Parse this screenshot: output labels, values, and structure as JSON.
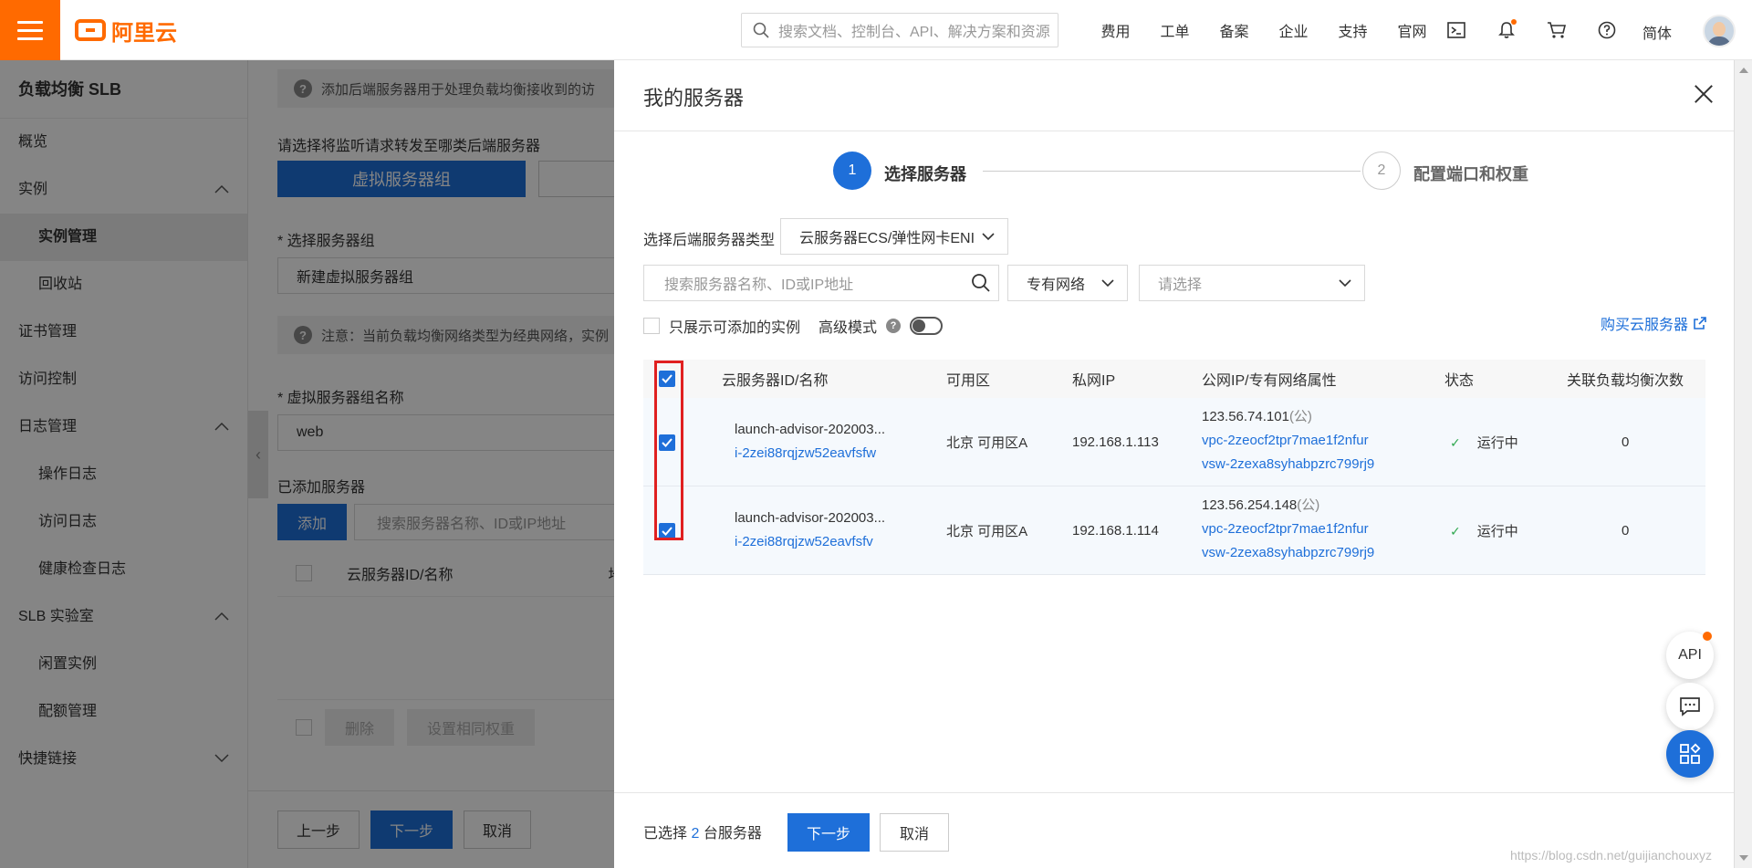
{
  "topbar": {
    "logo_text": "阿里云",
    "search_placeholder": "搜索文档、控制台、API、解决方案和资源",
    "nav": [
      "费用",
      "工单",
      "备案",
      "企业",
      "支持",
      "官网"
    ],
    "icons": [
      "terminal-icon",
      "bell-icon",
      "cart-icon",
      "help-icon"
    ],
    "lang": "简体"
  },
  "sidebar": {
    "title": "负载均衡 SLB",
    "items": [
      {
        "label": "概览",
        "level": 0
      },
      {
        "label": "实例",
        "level": 0,
        "expand": "up"
      },
      {
        "label": "实例管理",
        "level": 1,
        "active": true
      },
      {
        "label": "回收站",
        "level": 1
      },
      {
        "label": "证书管理",
        "level": 0
      },
      {
        "label": "访问控制",
        "level": 0
      },
      {
        "label": "日志管理",
        "level": 0,
        "expand": "up"
      },
      {
        "label": "操作日志",
        "level": 1
      },
      {
        "label": "访问日志",
        "level": 1
      },
      {
        "label": "健康检查日志",
        "level": 1
      },
      {
        "label": "SLB 实验室",
        "level": 0,
        "expand": "up"
      },
      {
        "label": "闲置实例",
        "level": 1
      },
      {
        "label": "配额管理",
        "level": 1
      },
      {
        "label": "快捷链接",
        "level": 0,
        "expand": "down"
      }
    ]
  },
  "underlay": {
    "tip": "添加后端服务器用于处理负载均衡接收到的访",
    "forward_label": "请选择将监听请求转发至哪类后端服务器",
    "vgroup_btn": "虚拟服务器组",
    "select_group_label": "* 选择服务器组",
    "select_group_value": "新建虚拟服务器组",
    "note": "注意：当前负载均衡网络类型为经典网络，实例",
    "group_name_label": "* 虚拟服务器组名称",
    "group_name_value": "web",
    "added_label": "已添加服务器",
    "add_btn": "添加",
    "search_placeholder": "搜索服务器名称、ID或IP地址",
    "col_name": "云服务器ID/名称",
    "col_more": "地",
    "delete_btn": "删除",
    "same_weight_btn": "设置相同权重",
    "prev_btn": "上一步",
    "next_btn": "下一步",
    "cancel_btn": "取消"
  },
  "drawer": {
    "title": "我的服务器",
    "steps": [
      {
        "num": "1",
        "label": "选择服务器",
        "state": "active"
      },
      {
        "num": "2",
        "label": "配置端口和权重",
        "state": "pending"
      }
    ],
    "type_label": "选择后端服务器类型",
    "type_value": "云服务器ECS/弹性网卡ENI",
    "search_placeholder": "搜索服务器名称、ID或IP地址",
    "network_value": "专有网络",
    "choose_placeholder": "请选择",
    "only_addable": "只展示可添加的实例",
    "advanced_mode": "高级模式",
    "buy_link": "购买云服务器",
    "columns": [
      "云服务器ID/名称",
      "可用区",
      "私网IP",
      "公网IP/专有网络属性",
      "状态",
      "关联负载均衡次数"
    ],
    "rows": [
      {
        "name": "launch-advisor-202003...",
        "id": "i-2zei88rqjzw52eavfsfw",
        "zone": "北京 可用区A",
        "private_ip": "192.168.1.113",
        "public_ip": "123.56.74.101",
        "public_tag": "(公)",
        "vpc": "vpc-2zeocf2tpr7mae1f2nfur",
        "vsw": "vsw-2zexa8syhabpzrc799rj9",
        "status": "运行中",
        "lb_count": "0"
      },
      {
        "name": "launch-advisor-202003...",
        "id": "i-2zei88rqjzw52eavfsfv",
        "zone": "北京 可用区A",
        "private_ip": "192.168.1.114",
        "public_ip": "123.56.254.148",
        "public_tag": "(公)",
        "vpc": "vpc-2zeocf2tpr7mae1f2nfur",
        "vsw": "vsw-2zexa8syhabpzrc799rj9",
        "status": "运行中",
        "lb_count": "0"
      }
    ],
    "footer": {
      "selected_prefix": "已选择",
      "selected_count": "2",
      "selected_suffix": "台服务器",
      "next_btn": "下一步",
      "cancel_btn": "取消"
    }
  },
  "float_buttons": {
    "api_label": "API"
  },
  "watermark": "https://blog.csdn.net/guijianchouxyz",
  "colors": {
    "brand": "#ff6a00",
    "primary": "#1e6fd9",
    "highlight": "#e02020",
    "success": "#2fa84f"
  }
}
